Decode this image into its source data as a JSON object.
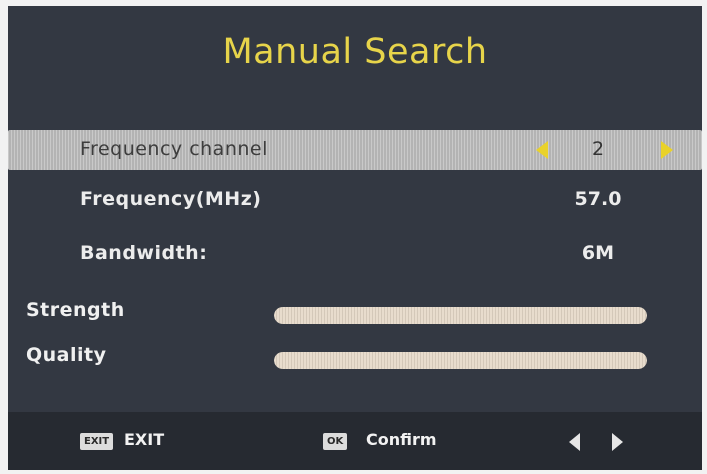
{
  "title": "Manual Search",
  "settings": [
    {
      "label": "Frequency channel",
      "value": "2",
      "selected": true
    },
    {
      "label": "Frequency(MHz)",
      "value": "57.0",
      "selected": false
    },
    {
      "label": "Bandwidth:",
      "value": "6M",
      "selected": false
    }
  ],
  "meters": {
    "strength": {
      "label": "Strength",
      "level": 1.0
    },
    "quality": {
      "label": "Quality",
      "level": 1.0
    }
  },
  "footer": {
    "exit_key": "EXIT",
    "exit_label": "EXIT",
    "ok_key": "OK",
    "ok_label": "Confirm"
  },
  "icons": {
    "value_left": "left-triangle-icon",
    "value_right": "right-triangle-icon",
    "nav_left": "left-arrow-icon",
    "nav_right": "right-arrow-icon"
  },
  "colors": {
    "title": "#e7d44a",
    "arrow": "#e9d22a",
    "background": "#333842",
    "footer": "#262a31"
  }
}
